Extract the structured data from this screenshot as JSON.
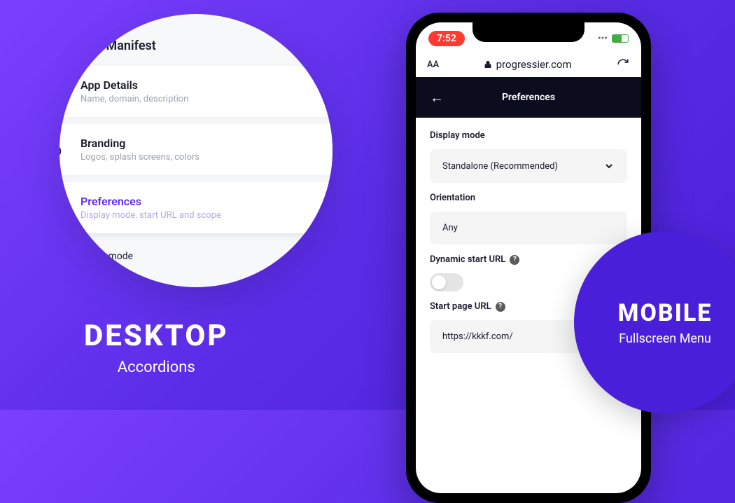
{
  "desktop": {
    "section_title": "App Manifest",
    "items": [
      {
        "title": "App Details",
        "desc": "Name, domain, description"
      },
      {
        "title": "Branding",
        "desc": "Logos, splash screens, colors"
      },
      {
        "title": "Preferences",
        "desc": "Display mode, start URL and scope"
      }
    ],
    "display_mode_label": "isplay mode",
    "big_label": "DESKTOP",
    "sub_label": "Accordions"
  },
  "mobile": {
    "time": "7:52",
    "text_size": "AA",
    "url": "progressier.com",
    "nav_title": "Preferences",
    "form": {
      "display_mode_label": "Display mode",
      "display_mode_value": "Standalone (Recommended)",
      "orientation_label": "Orientation",
      "orientation_value": "Any",
      "dynamic_url_label": "Dynamic start URL",
      "start_url_label": "Start page URL",
      "start_url_value": "https://kkkf.com/"
    },
    "big_label": "MOBILE",
    "sub_label": "Fullscreen Menu"
  }
}
